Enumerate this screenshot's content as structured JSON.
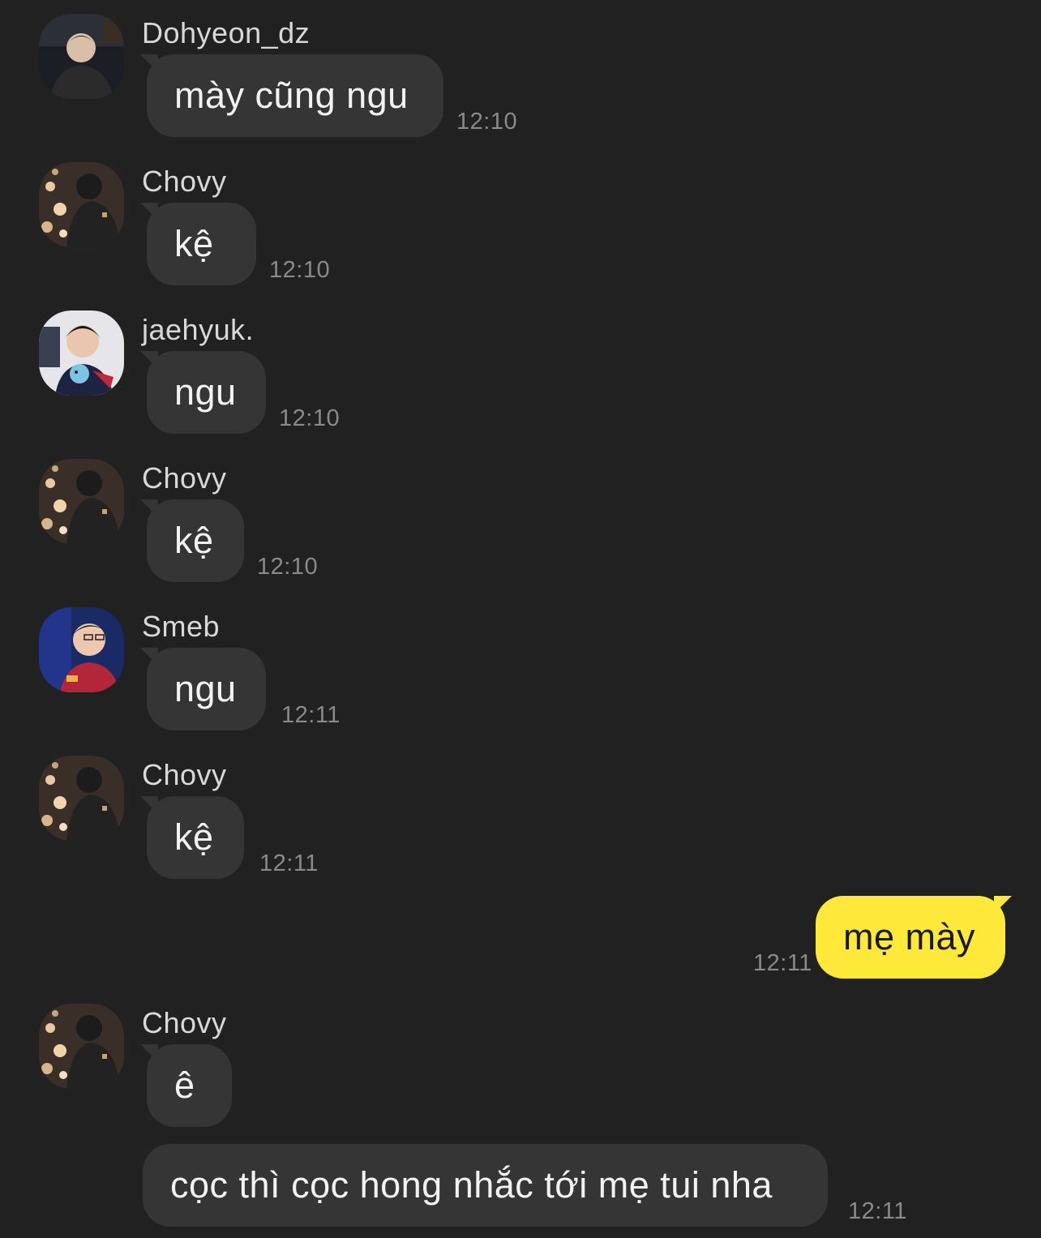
{
  "messages": [
    {
      "sender": "Dohyeon_dz",
      "avatar": "dohyeon-avatar",
      "text": "mày cũng ngu",
      "time": "12:10"
    },
    {
      "sender": "Chovy",
      "avatar": "chovy-avatar",
      "text": "kệ",
      "time": "12:10"
    },
    {
      "sender": "jaehyuk.",
      "avatar": "jaehyuk-avatar",
      "text": "ngu",
      "time": "12:10"
    },
    {
      "sender": "Chovy",
      "avatar": "chovy-avatar",
      "text": "kệ",
      "time": "12:10"
    },
    {
      "sender": "Smeb",
      "avatar": "smeb-avatar",
      "text": "ngu",
      "time": "12:11"
    },
    {
      "sender": "Chovy",
      "avatar": "chovy-avatar",
      "text": "kệ",
      "time": "12:11"
    },
    {
      "sender": "me",
      "text": "mẹ mày",
      "time": "12:11"
    },
    {
      "sender": "Chovy",
      "avatar": "chovy-avatar",
      "text": "ê"
    },
    {
      "sender": "Chovy",
      "text": "cọc thì cọc hong nhắc tới mẹ tui nha",
      "time": "12:11"
    }
  ],
  "colors": {
    "background": "#212121",
    "incoming_bubble": "#353535",
    "outgoing_bubble": "#fee93a"
  }
}
